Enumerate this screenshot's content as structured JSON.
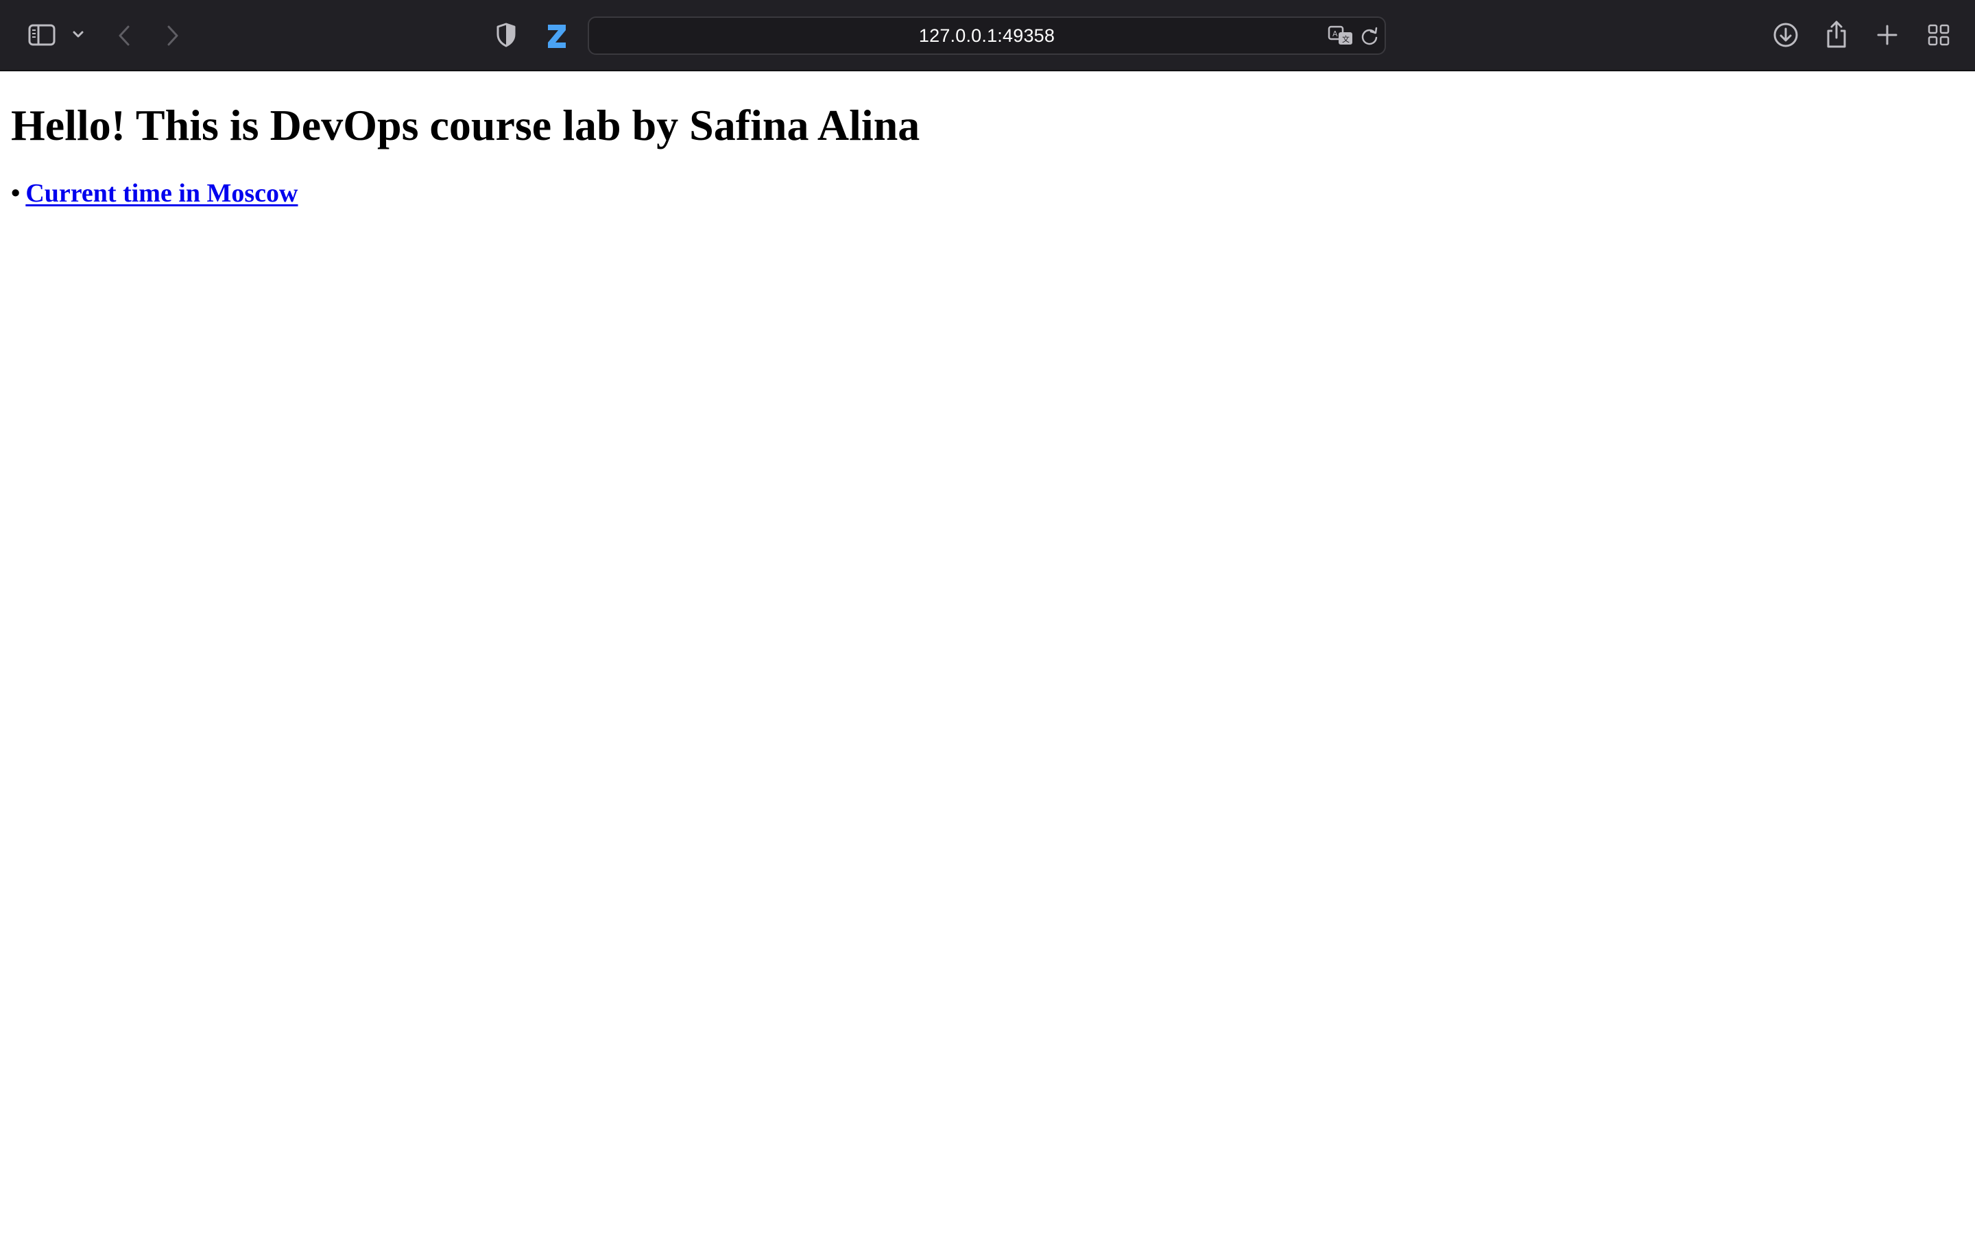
{
  "browser": {
    "address_bar": {
      "url": "127.0.0.1:49358"
    },
    "icons": {
      "sidebar": "sidebar-icon",
      "tab_group_menu": "chevron-down-icon",
      "back": "chevron-left-icon",
      "forward": "chevron-right-icon",
      "privacy": "shield-icon",
      "extension": "z-extension-icon",
      "translate": "translate-icon",
      "reload": "reload-icon",
      "downloads": "download-icon",
      "share": "share-icon",
      "new_tab": "plus-icon",
      "tab_overview": "grid-icon"
    },
    "colors": {
      "toolbar_bg": "#212025",
      "extension_accent": "#4aa3f5",
      "link": "#0000ee"
    }
  },
  "page": {
    "heading": "Hello! This is DevOps course lab by Safina Alina",
    "bullet": "•",
    "links": [
      {
        "label": "Current time in Moscow"
      }
    ]
  }
}
